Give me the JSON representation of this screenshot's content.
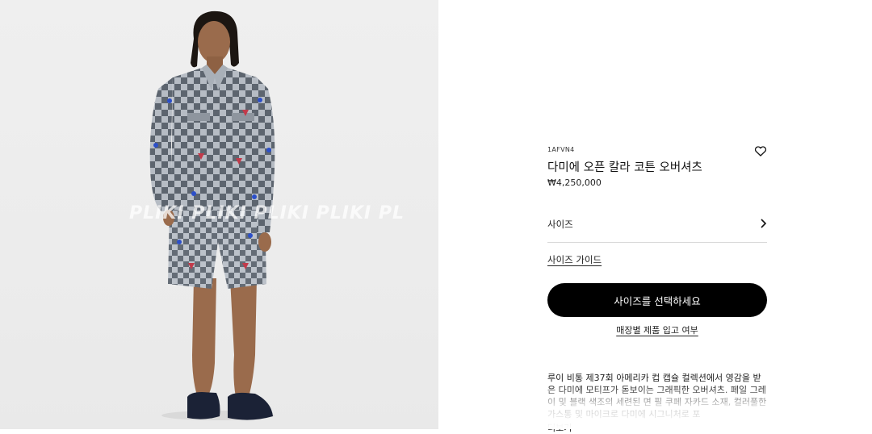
{
  "product_image": {
    "alt": "다미에 오픈 칼라 코튼 오버셔츠 착용 모델",
    "watermark": "PLIKI   PLIKI   PLIKI   PLIKI   PL"
  },
  "product": {
    "sku": "1AFVN4",
    "title": "다미에 오픈 칼라 코튼 오버셔츠",
    "price": "₩4,250,000",
    "size_label": "사이즈",
    "size_guide": "사이즈 가이드",
    "cta_label": "사이즈를 선택하세요",
    "store_availability": "매장별 제품 입고 여부",
    "description": "루이 비통 제37회 아메리카 컵 캡슐 컬렉션에서 영감을 받은 다미에 모티프가 돋보이는 그래픽한 오버셔츠. 페일 그레이 및 블랙 색조의 세련된 면 필 쿠페 자카드 소재, 컬러풀한 가스통 및 마이크로 다미에 시그니처로 포",
    "more": "더보기"
  },
  "icons": {
    "wishlist": "heart-outline-icon",
    "size_arrow": "chevron-right-icon"
  },
  "colors": {
    "cta_bg": "#000000",
    "cta_text": "#ffffff",
    "check_light": "#b4bac2",
    "check_dark": "#5b636d"
  }
}
